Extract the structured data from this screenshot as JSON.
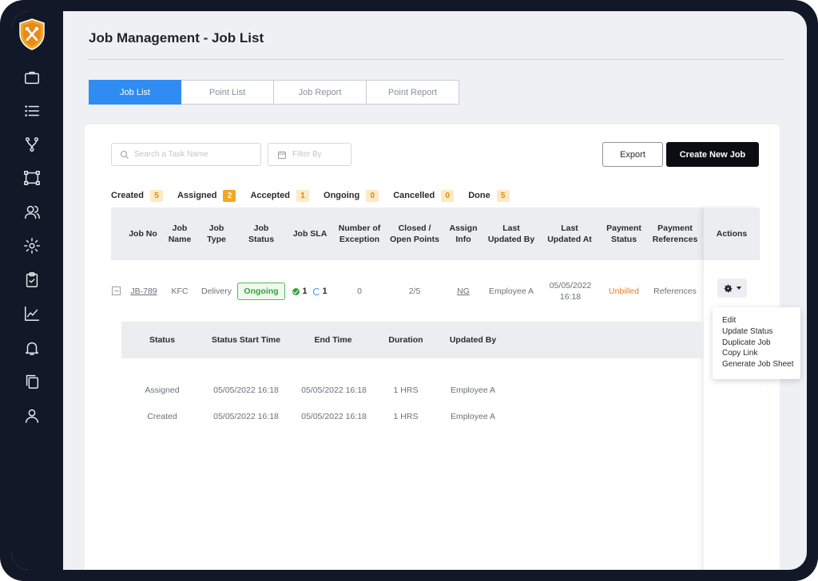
{
  "page": {
    "title": "Job Management - Job List"
  },
  "sidebar": {
    "icons": [
      "briefcase-icon",
      "list-icon",
      "branch-icon",
      "nodes-icon",
      "users-icon",
      "gear-icon",
      "clipboard-icon",
      "chart-icon",
      "bell-icon",
      "copy-icon",
      "user-icon"
    ]
  },
  "top_tabs": [
    {
      "label": "Job List",
      "active": true
    },
    {
      "label": "Point List",
      "active": false
    },
    {
      "label": "Job Report",
      "active": false
    },
    {
      "label": "Point Report",
      "active": false
    }
  ],
  "toolbar": {
    "search_placeholder": "Search a Task Name",
    "filter_placeholder": "Filter By",
    "export_label": "Export",
    "create_label": "Create New Job"
  },
  "status_tabs": [
    {
      "label": "Created",
      "count": "5"
    },
    {
      "label": "Assigned",
      "count": "2"
    },
    {
      "label": "Accepted",
      "count": "1"
    },
    {
      "label": "Ongoing",
      "count": "0"
    },
    {
      "label": "Cancelled",
      "count": "0"
    },
    {
      "label": "Done",
      "count": "5"
    }
  ],
  "table": {
    "headers": {
      "job_no": "Job No",
      "job_name": "Job Name",
      "job_type": "Job Type",
      "job_status": "Job Status",
      "job_sla": "Job SLA",
      "exceptions": "Number of Exception",
      "points": "Closed / Open Points",
      "assign": "Assign Info",
      "updated_by": "Last Updated By",
      "updated_at": "Last Updated At",
      "payment_status": "Payment Status",
      "payment_refs": "Payment References",
      "actions": "Actions"
    },
    "row": {
      "job_no": "JB-789",
      "job_name": "KFC",
      "job_type": "Delivery",
      "job_status": "Ongoing",
      "sla_done": "1",
      "sla_pending": "1",
      "exceptions": "0",
      "points": "2/5",
      "assign": "NG",
      "updated_by": "Employee A",
      "updated_at": "05/05/2022 16:18",
      "payment_status": "Unbilled",
      "payment_refs": "References"
    }
  },
  "actions_menu": [
    "Edit",
    "Update Status",
    "Duplicate Job",
    "Copy Link",
    "Generate Job Sheet"
  ],
  "history": {
    "headers": {
      "status": "Status",
      "start": "Status Start Time",
      "end": "End Time",
      "duration": "Duration",
      "updated_by": "Updated By"
    },
    "rows": [
      {
        "status": "Assigned",
        "start": "05/05/2022 16:18",
        "end": "05/05/2022 16:18",
        "duration": "1 HRS",
        "updated_by": "Employee A"
      },
      {
        "status": "Created",
        "start": "05/05/2022 16:18",
        "end": "05/05/2022 16:18",
        "duration": "1 HRS",
        "updated_by": "Employee A"
      }
    ]
  }
}
